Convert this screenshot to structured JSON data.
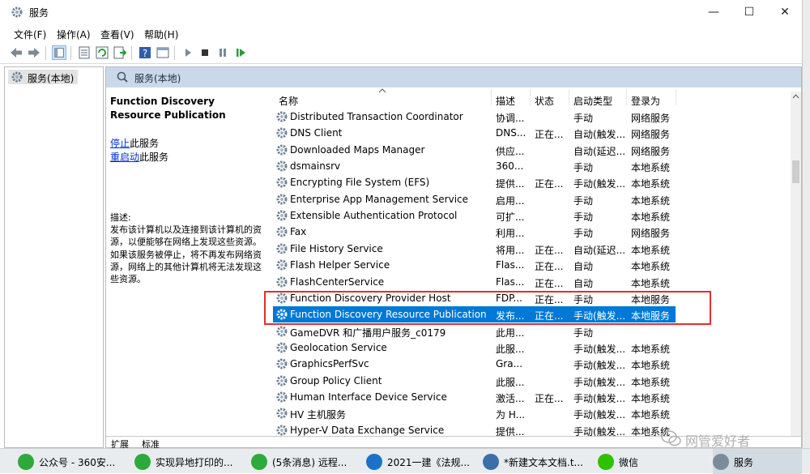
{
  "window": {
    "title": "服务"
  },
  "menu": [
    "文件(F)",
    "操作(A)",
    "查看(V)",
    "帮助(H)"
  ],
  "tree": {
    "node": "服务(本地)"
  },
  "panel": {
    "title": "服务(本地)"
  },
  "details": {
    "service_name": "Function Discovery Resource Publication",
    "stop_link": "停止",
    "stop_suffix": "此服务",
    "restart_link": "重启动",
    "restart_suffix": "此服务",
    "desc_label": "描述:",
    "desc_text": "发布该计算机以及连接到该计算机的资源，以便能够在网络上发现这些资源。如果该服务被停止，将不再发布网络资源，网络上的其他计算机将无法发现这些资源。"
  },
  "columns": [
    "名称",
    "描述",
    "状态",
    "启动类型",
    "登录为"
  ],
  "rows": [
    {
      "name": "Distributed Transaction Coordinator",
      "desc": "协调...",
      "status": "",
      "startup": "手动",
      "logon": "网络服务"
    },
    {
      "name": "DNS Client",
      "desc": "DNS...",
      "status": "正在...",
      "startup": "自动(触发...",
      "logon": "网络服务"
    },
    {
      "name": "Downloaded Maps Manager",
      "desc": "供应...",
      "status": "",
      "startup": "自动(延迟...",
      "logon": "网络服务"
    },
    {
      "name": "dsmainsrv",
      "desc": "360...",
      "status": "",
      "startup": "手动",
      "logon": "本地系统"
    },
    {
      "name": "Encrypting File System (EFS)",
      "desc": "提供...",
      "status": "正在...",
      "startup": "手动(触发...",
      "logon": "本地系统"
    },
    {
      "name": "Enterprise App Management Service",
      "desc": "启用...",
      "status": "",
      "startup": "手动",
      "logon": "本地系统"
    },
    {
      "name": "Extensible Authentication Protocol",
      "desc": "可扩...",
      "status": "",
      "startup": "手动",
      "logon": "本地系统"
    },
    {
      "name": "Fax",
      "desc": "利用...",
      "status": "",
      "startup": "手动",
      "logon": "网络服务"
    },
    {
      "name": "File History Service",
      "desc": "将用...",
      "status": "正在...",
      "startup": "自动(延迟...",
      "logon": "本地系统"
    },
    {
      "name": "Flash Helper Service",
      "desc": "Flas...",
      "status": "正在...",
      "startup": "自动",
      "logon": "本地系统"
    },
    {
      "name": "FlashCenterService",
      "desc": "Flas...",
      "status": "正在...",
      "startup": "自动",
      "logon": "本地系统"
    },
    {
      "name": "Function Discovery Provider Host",
      "desc": "FDP...",
      "status": "正在...",
      "startup": "手动",
      "logon": "本地服务"
    },
    {
      "name": "Function Discovery Resource Publication",
      "desc": "发布...",
      "status": "正在...",
      "startup": "手动(触发...",
      "logon": "本地服务"
    },
    {
      "name": "GameDVR 和广播用户服务_c0179",
      "desc": "此用...",
      "status": "",
      "startup": "手动",
      "logon": ""
    },
    {
      "name": "Geolocation Service",
      "desc": "此服...",
      "status": "",
      "startup": "手动(触发...",
      "logon": "本地系统"
    },
    {
      "name": "GraphicsPerfSvc",
      "desc": "Gra...",
      "status": "",
      "startup": "手动(触发...",
      "logon": "本地系统"
    },
    {
      "name": "Group Policy Client",
      "desc": "此服...",
      "status": "",
      "startup": "手动(触发...",
      "logon": "本地系统"
    },
    {
      "name": "Human Interface Device Service",
      "desc": "激活...",
      "status": "正在...",
      "startup": "手动(触发...",
      "logon": "本地系统"
    },
    {
      "name": "HV 主机服务",
      "desc": "为 H...",
      "status": "",
      "startup": "手动(触发...",
      "logon": "本地系统"
    },
    {
      "name": "Hyper-V Data Exchange Service",
      "desc": "提供...",
      "status": "",
      "startup": "手动(触发...",
      "logon": "本地系统"
    }
  ],
  "tabs": [
    "扩展",
    "标准"
  ],
  "taskbar": [
    {
      "label": "公众号 - 360安...",
      "color": "#2eaa3c"
    },
    {
      "label": "实现异地打印的...",
      "color": "#2eaa3c"
    },
    {
      "label": "(5条消息) 远程...",
      "color": "#2eaa3c"
    },
    {
      "label": "2021一建《法规...",
      "color": "#1a73c8"
    },
    {
      "label": "*新建文本文档.t...",
      "color": "#3b6fa8"
    },
    {
      "label": "微信",
      "color": "#2dc100"
    },
    {
      "label": "服务",
      "color": "#7a8c9c"
    }
  ],
  "watermark": "网管爱好者",
  "colors": {
    "selection": "#0078d7",
    "highlight_box": "#e0302c",
    "panel_header": "#c9d9ea"
  }
}
